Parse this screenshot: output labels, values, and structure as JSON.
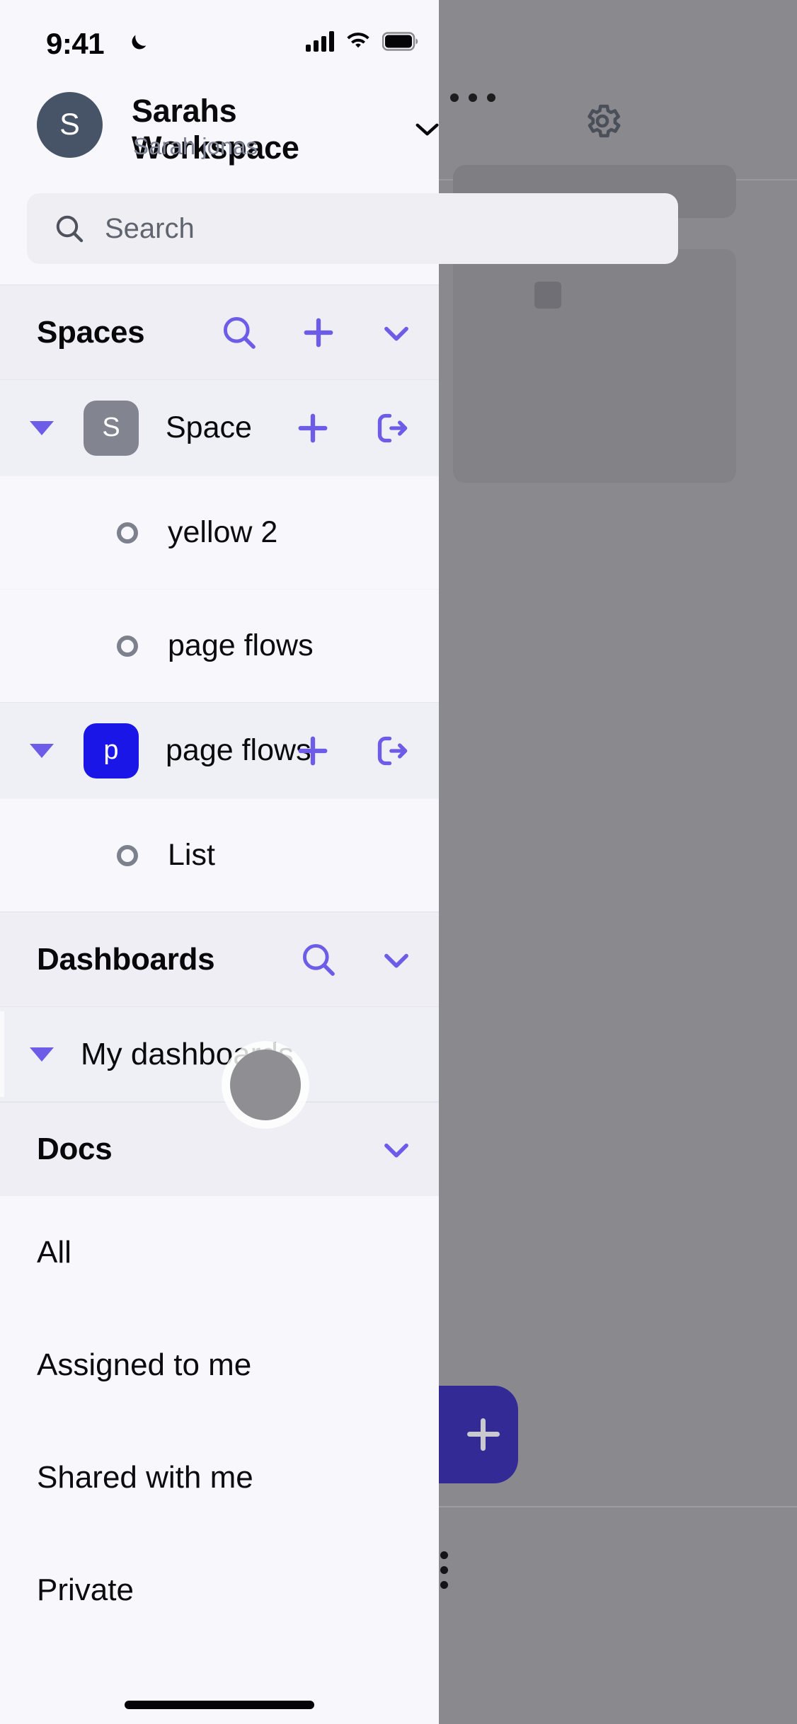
{
  "status_bar": {
    "time": "9:41",
    "moon_icon": "crescent-moon-icon",
    "signal_icon": "cellular-signal-icon",
    "wifi_icon": "wifi-icon",
    "battery_icon": "battery-full-icon"
  },
  "header": {
    "avatar_initial": "S",
    "avatar_color": "#475467",
    "workspace_name": "Sarahs Workspace",
    "chevron_icon": "chevron-down-icon",
    "user_name": "Sarah jonas",
    "settings_icon": "gear-icon"
  },
  "search": {
    "placeholder": "Search",
    "icon": "search-icon"
  },
  "spaces_section": {
    "title": "Spaces",
    "actions": [
      "search-icon",
      "plus-icon",
      "chevron-down-icon"
    ],
    "items": [
      {
        "name": "Space",
        "initial": "S",
        "avatar_color": "#82848f",
        "caret": "caret-down-icon",
        "actions": [
          "plus-icon",
          "open-external-icon"
        ],
        "children": [
          {
            "name": "yellow 2",
            "icon": "circle-outline-icon"
          },
          {
            "name": "page flows",
            "icon": "circle-outline-icon"
          }
        ]
      },
      {
        "name": "page flows",
        "initial": "p",
        "avatar_color": "#1a16e8",
        "caret": "caret-down-icon",
        "actions": [
          "plus-icon",
          "open-external-icon"
        ],
        "children": [
          {
            "name": "List",
            "icon": "circle-outline-icon"
          }
        ]
      }
    ]
  },
  "dashboards_section": {
    "title": "Dashboards",
    "actions": [
      "search-icon",
      "chevron-down-icon"
    ],
    "items": [
      {
        "name": "My dashboards",
        "caret": "caret-down-icon"
      }
    ]
  },
  "docs_section": {
    "title": "Docs",
    "actions": [
      "chevron-down-icon"
    ],
    "items": [
      {
        "label": "All"
      },
      {
        "label": "Assigned to me"
      },
      {
        "label": "Shared with me"
      },
      {
        "label": "Private"
      }
    ]
  },
  "background_app": {
    "overflow_menu_icon": "more-horizontal-icon",
    "vertical_menu_icon": "more-vertical-icon",
    "fab_icon": "plus-icon",
    "fab_color": "#332a96",
    "dim_color": "#8a8a8e"
  },
  "colors": {
    "accent": "#6c5ce7",
    "panel_bg": "#f8f8fc",
    "section_bg": "#eeeef4",
    "row_bg": "#eff0f5"
  }
}
